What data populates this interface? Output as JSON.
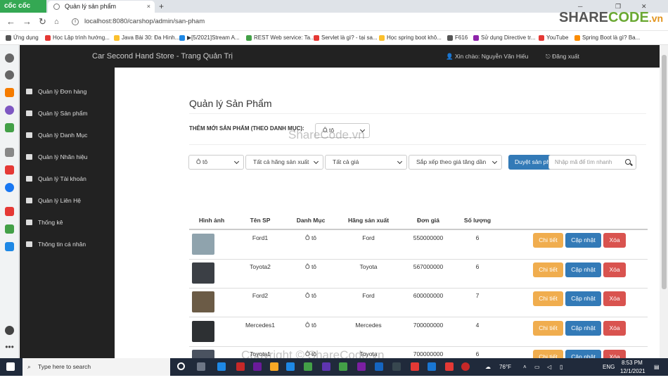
{
  "browser": {
    "brand": "cốc cốc",
    "tab_title": "Quản lý sản phẩm",
    "tab_close": "×",
    "new_tab": "+",
    "url": "localhost:8080/carshop/admin/san-pham",
    "bookmarks": [
      {
        "label": "Ứng dụng",
        "color": "#555"
      },
      {
        "label": "Học Lập trình hướng...",
        "color": "#e53935"
      },
      {
        "label": "Java Bài 30: Đa Hình...",
        "color": "#fbc02d"
      },
      {
        "label": "▶[5/2021]Stream A...",
        "color": "#1e88e5"
      },
      {
        "label": "REST Web service: Ta...",
        "color": "#43a047"
      },
      {
        "label": "Servlet là gì? - tại sa...",
        "color": "#e53935"
      },
      {
        "label": "Học spring boot khô...",
        "color": "#fbc02d"
      },
      {
        "label": "F616",
        "color": "#555"
      },
      {
        "label": "Sử dụng Directive tr...",
        "color": "#8e24aa"
      },
      {
        "label": "YouTube",
        "color": "#e53935"
      },
      {
        "label": "Spring Boot là gì? Ba...",
        "color": "#fb8c00"
      }
    ]
  },
  "logo": {
    "share": "SHARE",
    "code": "CODE",
    "tld": ".vn"
  },
  "topnav": {
    "store_title": "Car Second Hand Store - Trang Quản Trị",
    "greeting": "Xin chào: Nguyễn Văn Hiếu",
    "logout": "Đăng xuất"
  },
  "sidebar": {
    "items": [
      {
        "label": "Quản lý Đơn hàng"
      },
      {
        "label": "Quản lý Sản phẩm"
      },
      {
        "label": "Quản lý Danh Mục"
      },
      {
        "label": "Quản lý Nhãn hiệu"
      },
      {
        "label": "Quản lý Tài khoản"
      },
      {
        "label": "Quản lý Liên Hệ"
      },
      {
        "label": "Thống kê"
      },
      {
        "label": "Thông tin cá nhân"
      }
    ]
  },
  "main": {
    "page_title": "Quản lý Sản Phẩm",
    "add_new_label": "THÊM MỚI SẢN PHẨM (THEO DANH MỤC):",
    "add_new_category": "Ô tô",
    "filters": {
      "category": "Ô tô",
      "brand": "Tất cả hãng sản xuất",
      "price": "Tất cả giá",
      "sort": "Sắp xếp theo giá tăng dần",
      "browse_button": "Duyệt sản phẩm",
      "search_placeholder": "Nhập mã để tìm nhanh"
    },
    "table": {
      "headers": [
        "Hình ảnh",
        "Tên SP",
        "Danh Mục",
        "Hãng sản xuất",
        "Đơn giá",
        "Số lượng"
      ],
      "actions": {
        "detail": "Chi tiết",
        "update": "Cập nhật",
        "delete": "Xóa"
      },
      "rows": [
        {
          "name": "Ford1",
          "category": "Ô tô",
          "brand": "Ford",
          "price": "550000000",
          "qty": "6",
          "thumb_color": "#8fa3ad"
        },
        {
          "name": "Toyota2",
          "category": "Ô tô",
          "brand": "Toyota",
          "price": "567000000",
          "qty": "6",
          "thumb_color": "#3b3f45"
        },
        {
          "name": "Ford2",
          "category": "Ô tô",
          "brand": "Ford",
          "price": "600000000",
          "qty": "7",
          "thumb_color": "#6b5b46"
        },
        {
          "name": "Mercedes1",
          "category": "Ô tô",
          "brand": "Mercedes",
          "price": "700000000",
          "qty": "4",
          "thumb_color": "#2d3033"
        },
        {
          "name": "Toyota1",
          "category": "Ô tô",
          "brand": "Toyota",
          "price": "700000000",
          "qty": "6",
          "thumb_color": "#4a5260"
        }
      ]
    }
  },
  "watermarks": {
    "center": "ShareCode.vn",
    "bottom": "Copyright © ShareCode.vn"
  },
  "taskbar": {
    "search_placeholder": "Type here to search",
    "weather": "76°F",
    "language": "ENG",
    "time": "8:53 PM",
    "date": "12/1/2021"
  }
}
